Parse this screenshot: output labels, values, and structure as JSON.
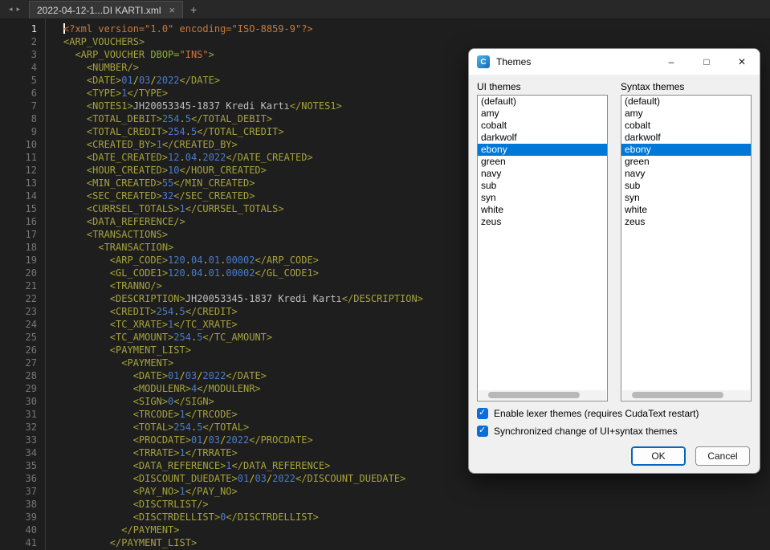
{
  "topbar": {
    "nav_back": "◂",
    "nav_forward": "▸",
    "tab_title": "2022-04-12-1...DI KARTI.xml",
    "tab_close": "×",
    "new_tab": "+"
  },
  "editor": {
    "current_line": 1,
    "colors": {
      "background": "#1e1e1e",
      "decl": "#c87a3f",
      "tag": "#a6a33c",
      "attr": "#8bae3a",
      "string": "#cf7440",
      "number": "#4a7cc9",
      "punct": "#c9b930",
      "text": "#bfbfbf",
      "selection": "#0078d7",
      "accent": "#0b6dd6"
    },
    "lines": [
      {
        "n": 1,
        "tokens": [
          [
            "decl",
            "<?xml version=\"1.0\" encoding=\"ISO-8859-9\"?>"
          ]
        ]
      },
      {
        "n": 2,
        "tokens": [
          [
            "tag",
            "<ARP_VOUCHERS>"
          ]
        ]
      },
      {
        "n": 3,
        "tokens": [
          [
            "tag",
            "  <ARP_VOUCHER "
          ],
          [
            "attr",
            "DBOP="
          ],
          [
            "str",
            "\"INS\""
          ],
          [
            "tag",
            ">"
          ]
        ]
      },
      {
        "n": 4,
        "tokens": [
          [
            "tag",
            "    <NUMBER/>"
          ]
        ]
      },
      {
        "n": 5,
        "tokens": [
          [
            "tag",
            "    <DATE>"
          ],
          [
            "num",
            "01"
          ],
          [
            "pun",
            "/"
          ],
          [
            "num",
            "03"
          ],
          [
            "pun",
            "/"
          ],
          [
            "num",
            "2022"
          ],
          [
            "tag",
            "</DATE>"
          ]
        ]
      },
      {
        "n": 6,
        "tokens": [
          [
            "tag",
            "    <TYPE>"
          ],
          [
            "num",
            "1"
          ],
          [
            "tag",
            "</TYPE>"
          ]
        ]
      },
      {
        "n": 7,
        "tokens": [
          [
            "tag",
            "    <NOTES1>"
          ],
          [
            "txt",
            "JH20053345-1837 Kredi Kartı"
          ],
          [
            "tag",
            "</NOTES1>"
          ]
        ]
      },
      {
        "n": 8,
        "tokens": [
          [
            "tag",
            "    <TOTAL_DEBIT>"
          ],
          [
            "num",
            "254"
          ],
          [
            "pun",
            "."
          ],
          [
            "num",
            "5"
          ],
          [
            "tag",
            "</TOTAL_DEBIT>"
          ]
        ]
      },
      {
        "n": 9,
        "tokens": [
          [
            "tag",
            "    <TOTAL_CREDIT>"
          ],
          [
            "num",
            "254"
          ],
          [
            "pun",
            "."
          ],
          [
            "num",
            "5"
          ],
          [
            "tag",
            "</TOTAL_CREDIT>"
          ]
        ]
      },
      {
        "n": 10,
        "tokens": [
          [
            "tag",
            "    <CREATED_BY>"
          ],
          [
            "num",
            "1"
          ],
          [
            "tag",
            "</CREATED_BY>"
          ]
        ]
      },
      {
        "n": 11,
        "tokens": [
          [
            "tag",
            "    <DATE_CREATED>"
          ],
          [
            "num",
            "12"
          ],
          [
            "pun",
            "."
          ],
          [
            "num",
            "04"
          ],
          [
            "pun",
            "."
          ],
          [
            "num",
            "2022"
          ],
          [
            "tag",
            "</DATE_CREATED>"
          ]
        ]
      },
      {
        "n": 12,
        "tokens": [
          [
            "tag",
            "    <HOUR_CREATED>"
          ],
          [
            "num",
            "10"
          ],
          [
            "tag",
            "</HOUR_CREATED>"
          ]
        ]
      },
      {
        "n": 13,
        "tokens": [
          [
            "tag",
            "    <MIN_CREATED>"
          ],
          [
            "num",
            "55"
          ],
          [
            "tag",
            "</MIN_CREATED>"
          ]
        ]
      },
      {
        "n": 14,
        "tokens": [
          [
            "tag",
            "    <SEC_CREATED>"
          ],
          [
            "num",
            "32"
          ],
          [
            "tag",
            "</SEC_CREATED>"
          ]
        ]
      },
      {
        "n": 15,
        "tokens": [
          [
            "tag",
            "    <CURRSEL_TOTALS>"
          ],
          [
            "num",
            "1"
          ],
          [
            "tag",
            "</CURRSEL_TOTALS>"
          ]
        ]
      },
      {
        "n": 16,
        "tokens": [
          [
            "tag",
            "    <DATA_REFERENCE/>"
          ]
        ]
      },
      {
        "n": 17,
        "tokens": [
          [
            "tag",
            "    <TRANSACTIONS>"
          ]
        ]
      },
      {
        "n": 18,
        "tokens": [
          [
            "tag",
            "      <TRANSACTION>"
          ]
        ]
      },
      {
        "n": 19,
        "tokens": [
          [
            "tag",
            "        <ARP_CODE>"
          ],
          [
            "num",
            "120"
          ],
          [
            "pun",
            "."
          ],
          [
            "num",
            "04"
          ],
          [
            "pun",
            "."
          ],
          [
            "num",
            "01"
          ],
          [
            "pun",
            "."
          ],
          [
            "num",
            "00002"
          ],
          [
            "tag",
            "</ARP_CODE>"
          ]
        ]
      },
      {
        "n": 20,
        "tokens": [
          [
            "tag",
            "        <GL_CODE1>"
          ],
          [
            "num",
            "120"
          ],
          [
            "pun",
            "."
          ],
          [
            "num",
            "04"
          ],
          [
            "pun",
            "."
          ],
          [
            "num",
            "01"
          ],
          [
            "pun",
            "."
          ],
          [
            "num",
            "00002"
          ],
          [
            "tag",
            "</GL_CODE1>"
          ]
        ]
      },
      {
        "n": 21,
        "tokens": [
          [
            "tag",
            "        <TRANNO/>"
          ]
        ]
      },
      {
        "n": 22,
        "tokens": [
          [
            "tag",
            "        <DESCRIPTION>"
          ],
          [
            "txt",
            "JH20053345-1837 Kredi Kartı"
          ],
          [
            "tag",
            "</DESCRIPTION>"
          ]
        ]
      },
      {
        "n": 23,
        "tokens": [
          [
            "tag",
            "        <CREDIT>"
          ],
          [
            "num",
            "254"
          ],
          [
            "pun",
            "."
          ],
          [
            "num",
            "5"
          ],
          [
            "tag",
            "</CREDIT>"
          ]
        ]
      },
      {
        "n": 24,
        "tokens": [
          [
            "tag",
            "        <TC_XRATE>"
          ],
          [
            "num",
            "1"
          ],
          [
            "tag",
            "</TC_XRATE>"
          ]
        ]
      },
      {
        "n": 25,
        "tokens": [
          [
            "tag",
            "        <TC_AMOUNT>"
          ],
          [
            "num",
            "254"
          ],
          [
            "pun",
            "."
          ],
          [
            "num",
            "5"
          ],
          [
            "tag",
            "</TC_AMOUNT>"
          ]
        ]
      },
      {
        "n": 26,
        "tokens": [
          [
            "tag",
            "        <PAYMENT_LIST>"
          ]
        ]
      },
      {
        "n": 27,
        "tokens": [
          [
            "tag",
            "          <PAYMENT>"
          ]
        ]
      },
      {
        "n": 28,
        "tokens": [
          [
            "tag",
            "            <DATE>"
          ],
          [
            "num",
            "01"
          ],
          [
            "pun",
            "/"
          ],
          [
            "num",
            "03"
          ],
          [
            "pun",
            "/"
          ],
          [
            "num",
            "2022"
          ],
          [
            "tag",
            "</DATE>"
          ]
        ]
      },
      {
        "n": 29,
        "tokens": [
          [
            "tag",
            "            <MODULENR>"
          ],
          [
            "num",
            "4"
          ],
          [
            "tag",
            "</MODULENR>"
          ]
        ]
      },
      {
        "n": 30,
        "tokens": [
          [
            "tag",
            "            <SIGN>"
          ],
          [
            "num",
            "0"
          ],
          [
            "tag",
            "</SIGN>"
          ]
        ]
      },
      {
        "n": 31,
        "tokens": [
          [
            "tag",
            "            <TRCODE>"
          ],
          [
            "num",
            "1"
          ],
          [
            "tag",
            "</TRCODE>"
          ]
        ]
      },
      {
        "n": 32,
        "tokens": [
          [
            "tag",
            "            <TOTAL>"
          ],
          [
            "num",
            "254"
          ],
          [
            "pun",
            "."
          ],
          [
            "num",
            "5"
          ],
          [
            "tag",
            "</TOTAL>"
          ]
        ]
      },
      {
        "n": 33,
        "tokens": [
          [
            "tag",
            "            <PROCDATE>"
          ],
          [
            "num",
            "01"
          ],
          [
            "pun",
            "/"
          ],
          [
            "num",
            "03"
          ],
          [
            "pun",
            "/"
          ],
          [
            "num",
            "2022"
          ],
          [
            "tag",
            "</PROCDATE>"
          ]
        ]
      },
      {
        "n": 34,
        "tokens": [
          [
            "tag",
            "            <TRRATE>"
          ],
          [
            "num",
            "1"
          ],
          [
            "tag",
            "</TRRATE>"
          ]
        ]
      },
      {
        "n": 35,
        "tokens": [
          [
            "tag",
            "            <DATA_REFERENCE>"
          ],
          [
            "num",
            "1"
          ],
          [
            "tag",
            "</DATA_REFERENCE>"
          ]
        ]
      },
      {
        "n": 36,
        "tokens": [
          [
            "tag",
            "            <DISCOUNT_DUEDATE>"
          ],
          [
            "num",
            "01"
          ],
          [
            "pun",
            "/"
          ],
          [
            "num",
            "03"
          ],
          [
            "pun",
            "/"
          ],
          [
            "num",
            "2022"
          ],
          [
            "tag",
            "</DISCOUNT_DUEDATE>"
          ]
        ]
      },
      {
        "n": 37,
        "tokens": [
          [
            "tag",
            "            <PAY_NO>"
          ],
          [
            "num",
            "1"
          ],
          [
            "tag",
            "</PAY_NO>"
          ]
        ]
      },
      {
        "n": 38,
        "tokens": [
          [
            "tag",
            "            <DISCTRLIST/>"
          ]
        ]
      },
      {
        "n": 39,
        "tokens": [
          [
            "tag",
            "            <DISCTRDELLIST>"
          ],
          [
            "num",
            "0"
          ],
          [
            "tag",
            "</DISCTRDELLIST>"
          ]
        ]
      },
      {
        "n": 40,
        "tokens": [
          [
            "tag",
            "          </PAYMENT>"
          ]
        ]
      },
      {
        "n": 41,
        "tokens": [
          [
            "tag",
            "        </PAYMENT_LIST>"
          ]
        ]
      }
    ]
  },
  "dialog": {
    "title": "Themes",
    "icon_glyph": "C",
    "minimize": "–",
    "maximize": "□",
    "close": "✕",
    "ui_themes_label": "UI themes",
    "syntax_themes_label": "Syntax themes",
    "themes": [
      "(default)",
      "amy",
      "cobalt",
      "darkwolf",
      "ebony",
      "green",
      "navy",
      "sub",
      "syn",
      "white",
      "zeus"
    ],
    "selected_theme": "ebony",
    "checkboxes": [
      {
        "label": "Enable lexer themes (requires CudaText restart)",
        "checked": true
      },
      {
        "label": "Synchronized change of UI+syntax themes",
        "checked": true
      }
    ],
    "ok_label": "OK",
    "cancel_label": "Cancel"
  }
}
